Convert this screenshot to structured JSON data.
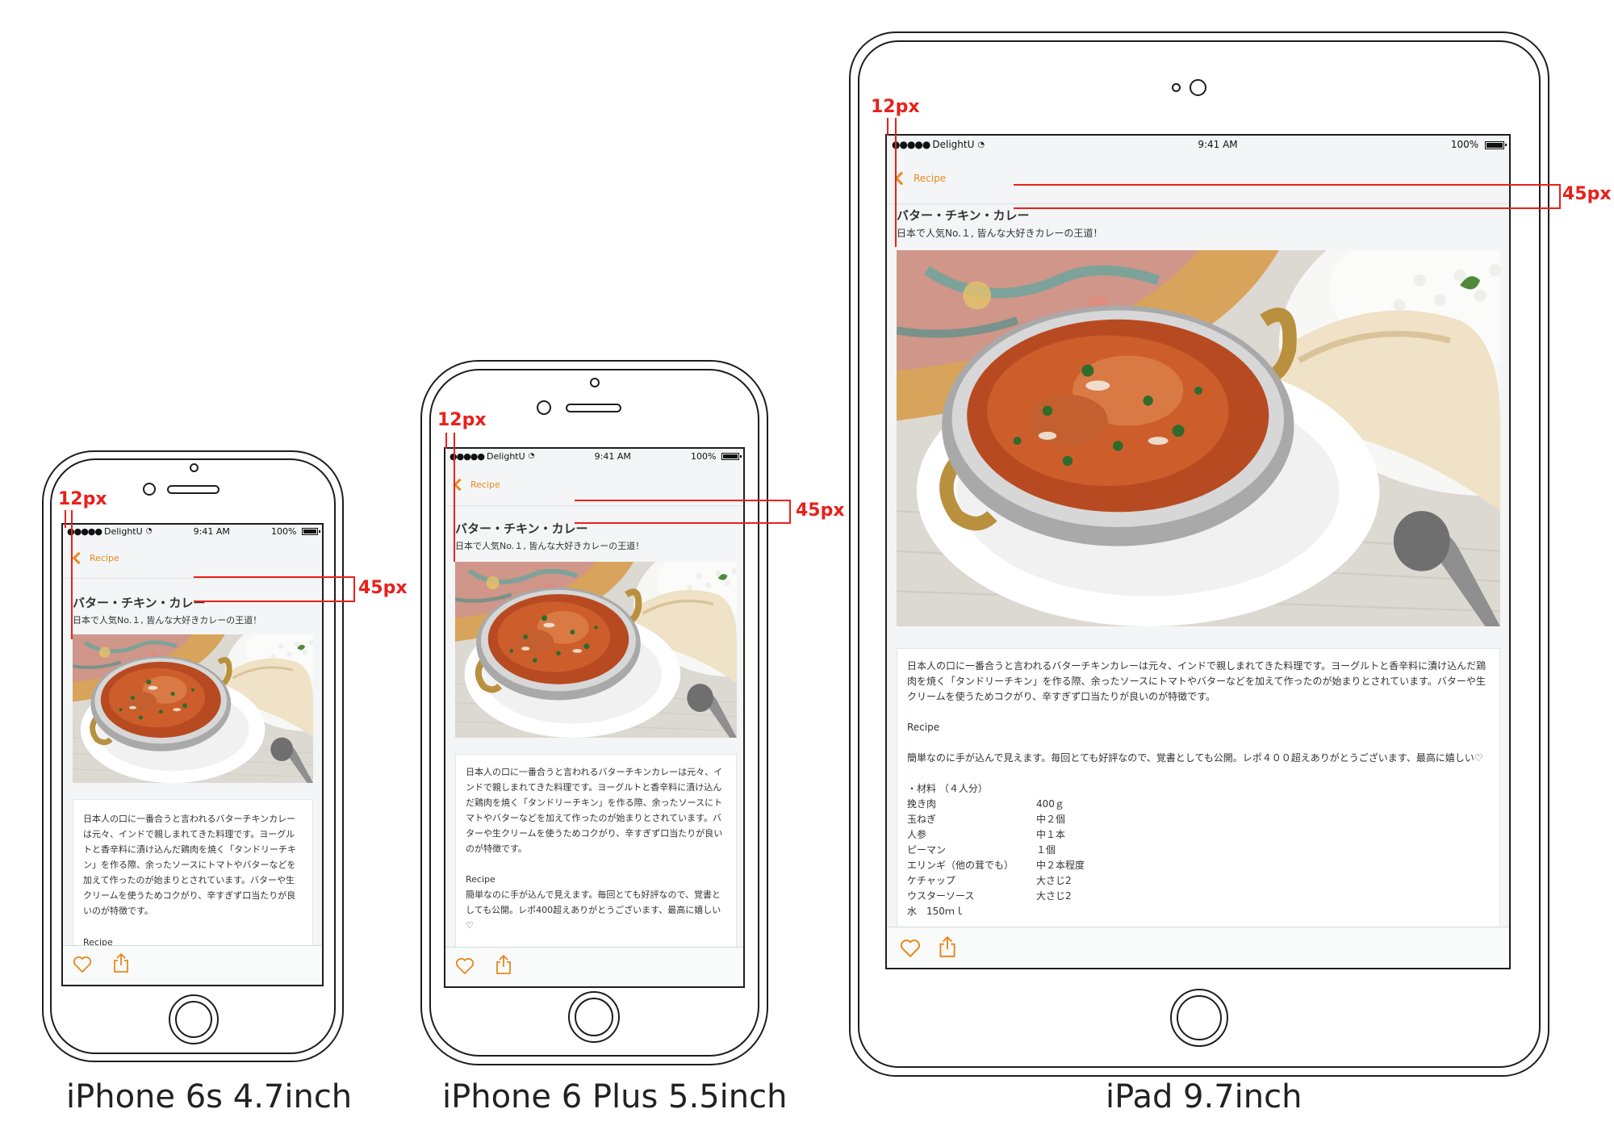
{
  "labels": {
    "iphone6s": "iPhone 6s 4.7inch",
    "iphone6plus": "iPhone 6 Plus 5.5inch",
    "ipad": "iPad 9.7inch"
  },
  "measure": {
    "left_margin": "12px",
    "top_gap": "45px"
  },
  "status_bar": {
    "carrier": "DelightU",
    "time": "9:41 AM",
    "battery": "100%"
  },
  "nav": {
    "back_label": "Recipe"
  },
  "recipe": {
    "title": "バター・チキン・カレー",
    "subtitle": "日本で人気No.１, 皆んな大好きカレーの王道！",
    "description": "日本人の口に一番合うと言われるバターチキンカレーは元々、インドで親しまれてきた料理です。ヨーグルトと香辛料に漬け込んだ鶏肉を焼く「タンドリーチキン」を作る際、余ったソースにトマトやバターなどを加えて作ったのが始まりとされています。バターや生クリームを使うためコクがり、辛すぎず口当たりが良いのが特徴です。",
    "section_label": "Recipe",
    "section_label_clipped": "Recipe",
    "note": "簡単なのに手が込んで見えます。毎回とても好評なので、覚書としても公開。レポ400超えありがとうございます、最高に嬉しい♡",
    "note_ipad": "簡単なのに手が込んで見えます。毎回とても好評なので、覚書としても公開。レポ４００超えありがとうございます、最高に嬉しい♡",
    "ingredients_header": "・材料 （４人分）",
    "ingredients": [
      {
        "name": "挽き肉",
        "qty": "400ｇ"
      },
      {
        "name": "玉ねぎ",
        "qty": "中２個"
      },
      {
        "name": "人参",
        "qty": "中１本"
      },
      {
        "name": "ピーマン",
        "qty": "１個"
      },
      {
        "name": "エリンギ（他の茸でも）",
        "qty": "中２本程度"
      },
      {
        "name": "ケチャップ",
        "qty": "大さじ2"
      },
      {
        "name": "ウスターソース",
        "qty": "大さじ2"
      }
    ],
    "ingredients_clipped": "水　150ｍｌ"
  },
  "icons": {
    "favorite": "heart-icon",
    "share": "share-icon",
    "back": "chevron-left-icon",
    "wifi": "wifi-icon",
    "battery": "battery-icon",
    "signal": "signal-dots-icon"
  },
  "colors": {
    "accent": "#e8891f",
    "measure": "#e8211a",
    "screen_bg": "#f3f5f6"
  }
}
